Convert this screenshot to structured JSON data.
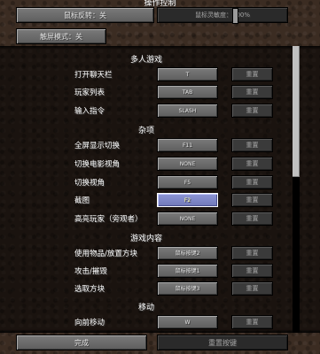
{
  "header": {
    "section_title": "操作控制",
    "mouse_invert": "鼠标反转：关",
    "sensitivity": "鼠标灵敏度：100%",
    "touchscreen": "触屏模式：关"
  },
  "categories": {
    "multiplayer": "多人游戏",
    "misc": "杂项",
    "gameplay": "游戏内容",
    "movement": "移动"
  },
  "reset_label": "重置",
  "bindings": {
    "chat": {
      "label": "打开聊天栏",
      "key": "T"
    },
    "playerlist": {
      "label": "玩家列表",
      "key": "TAB"
    },
    "command": {
      "label": "输入指令",
      "key": "SLASH"
    },
    "fullscreen": {
      "label": "全屏显示切换",
      "key": "F11"
    },
    "cinematic": {
      "label": "切换电影视角",
      "key": "NONE"
    },
    "perspective": {
      "label": "切换视角",
      "key": "F5"
    },
    "screenshot": {
      "label": "截图",
      "key": "F2"
    },
    "spectator": {
      "label": "高亮玩家（旁观者）",
      "key": "NONE"
    },
    "use": {
      "label": "使用物品/放置方块",
      "key": "鼠标按键2"
    },
    "attack": {
      "label": "攻击/摧毁",
      "key": "鼠标按键1"
    },
    "pick": {
      "label": "选取方块",
      "key": "鼠标按键3"
    },
    "forward": {
      "label": "向前移动",
      "key": "W"
    }
  },
  "footer": {
    "done": "完成",
    "reset_keys": "重置按键"
  }
}
